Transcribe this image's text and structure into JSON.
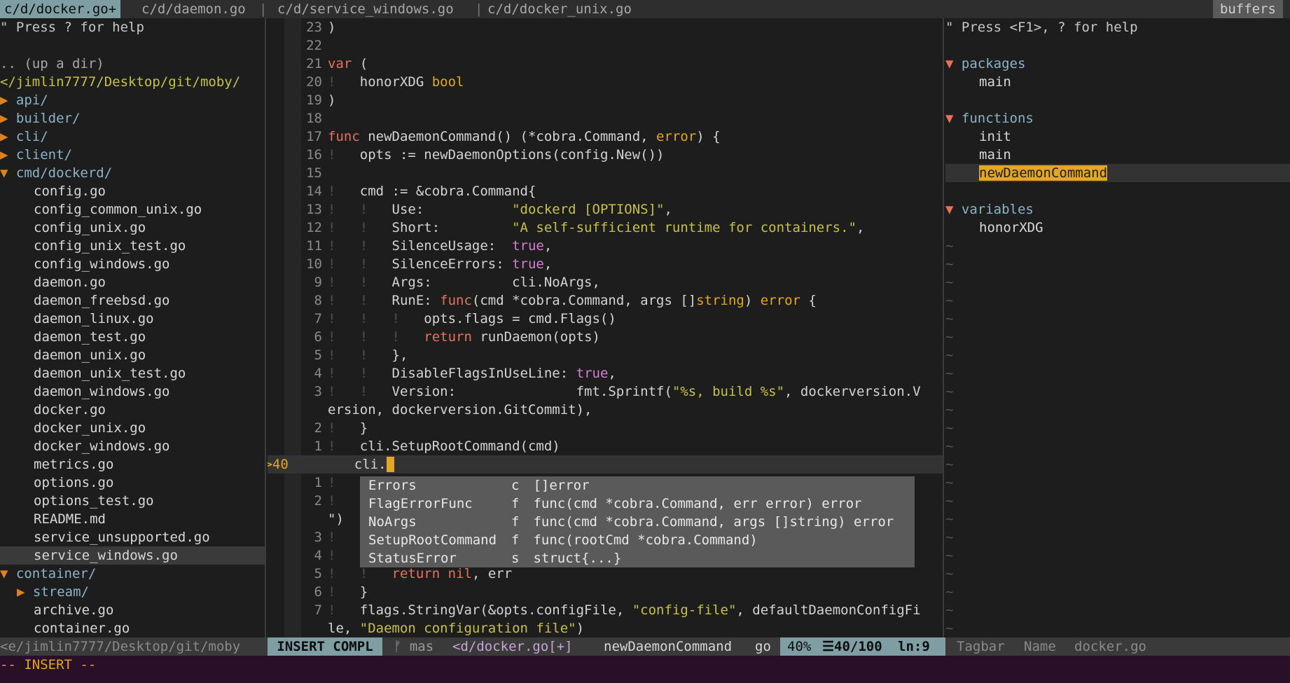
{
  "tabs": {
    "items": [
      {
        "label": "c/d/docker.go+",
        "active": true
      },
      {
        "label": "c/d/daemon.go",
        "active": false
      },
      {
        "label": "c/d/service_windows.go",
        "active": false
      },
      {
        "label": "c/d/docker_unix.go",
        "active": false
      }
    ],
    "separator": "|",
    "buffers_label": "buffers"
  },
  "tree": {
    "help": "\" Press ? for help",
    "up": ".. (up a dir)",
    "root": "</jimlin7777/Desktop/git/moby/",
    "entries": [
      {
        "type": "dir",
        "arrow": "▶",
        "name": "api/"
      },
      {
        "type": "dir",
        "arrow": "▶",
        "name": "builder/"
      },
      {
        "type": "dir",
        "arrow": "▶",
        "name": "cli/"
      },
      {
        "type": "dir",
        "arrow": "▶",
        "name": "client/"
      },
      {
        "type": "dir",
        "arrow": "▼",
        "name": "cmd/dockerd/"
      },
      {
        "type": "file",
        "name": "config.go"
      },
      {
        "type": "file",
        "name": "config_common_unix.go"
      },
      {
        "type": "file",
        "name": "config_unix.go"
      },
      {
        "type": "file",
        "name": "config_unix_test.go"
      },
      {
        "type": "file",
        "name": "config_windows.go"
      },
      {
        "type": "file",
        "name": "daemon.go"
      },
      {
        "type": "file",
        "name": "daemon_freebsd.go"
      },
      {
        "type": "file",
        "name": "daemon_linux.go"
      },
      {
        "type": "file",
        "name": "daemon_test.go"
      },
      {
        "type": "file",
        "name": "daemon_unix.go"
      },
      {
        "type": "file",
        "name": "daemon_unix_test.go"
      },
      {
        "type": "file",
        "name": "daemon_windows.go"
      },
      {
        "type": "file",
        "name": "docker.go"
      },
      {
        "type": "file",
        "name": "docker_unix.go"
      },
      {
        "type": "file",
        "name": "docker_windows.go"
      },
      {
        "type": "file",
        "name": "metrics.go"
      },
      {
        "type": "file",
        "name": "options.go"
      },
      {
        "type": "file",
        "name": "options_test.go"
      },
      {
        "type": "file",
        "name": "README.md"
      },
      {
        "type": "file",
        "name": "service_unsupported.go"
      },
      {
        "type": "file",
        "name": "service_windows.go",
        "selected": true
      },
      {
        "type": "dir",
        "arrow": "▼",
        "name": "container/"
      },
      {
        "type": "subdir",
        "arrow": "▶",
        "name": "stream/"
      },
      {
        "type": "file",
        "name": "archive.go"
      },
      {
        "type": "file",
        "name": "container.go"
      }
    ]
  },
  "editor": {
    "lines": [
      {
        "n": "23",
        "html": ")"
      },
      {
        "n": "22",
        "html": ""
      },
      {
        "n": "21",
        "html": "<span class=\"kw\">var</span> ("
      },
      {
        "n": "20",
        "html": "<span class=\"bang\">!</span>   honorXDG <span class=\"ty\">bool</span>"
      },
      {
        "n": "19",
        "html": ")"
      },
      {
        "n": "18",
        "html": ""
      },
      {
        "n": "17",
        "html": "<span class=\"kw\">func</span> newDaemonCommand() (*cobra.Command, <span class=\"ty\">error</span>) {"
      },
      {
        "n": "16",
        "html": "<span class=\"bang\">!</span>   opts := newDaemonOptions(config.New())"
      },
      {
        "n": "15",
        "html": ""
      },
      {
        "n": "14",
        "html": "<span class=\"bang\">!</span>   cmd := &amp;cobra.Command{"
      },
      {
        "n": "13",
        "html": "<span class=\"bang\">!   !</span>   Use:           <span class=\"str\">\"dockerd [OPTIONS]\"</span>,"
      },
      {
        "n": "12",
        "html": "<span class=\"bang\">!   !</span>   Short:         <span class=\"str\">\"A self-sufficient runtime for containers.\"</span>,"
      },
      {
        "n": "11",
        "html": "<span class=\"bang\">!   !</span>   SilenceUsage:  <span class=\"bool\">true</span>,"
      },
      {
        "n": "10",
        "html": "<span class=\"bang\">!   !</span>   SilenceErrors: <span class=\"bool\">true</span>,"
      },
      {
        "n": "9",
        "html": "<span class=\"bang\">!   !</span>   Args:          cli.NoArgs,"
      },
      {
        "n": "8",
        "html": "<span class=\"bang\">!   !</span>   RunE: <span class=\"kw\">func</span>(cmd *cobra.Command, args []<span class=\"ty\">string</span>) <span class=\"ty\">error</span> {"
      },
      {
        "n": "7",
        "html": "<span class=\"bang\">!   !   !</span>   opts.flags = cmd.Flags()"
      },
      {
        "n": "6",
        "html": "<span class=\"bang\">!   !   !</span>   <span class=\"kw\">return</span> runDaemon(opts)"
      },
      {
        "n": "5",
        "html": "<span class=\"bang\">!   !</span>   },"
      },
      {
        "n": "4",
        "html": "<span class=\"bang\">!   !</span>   DisableFlagsInUseLine: <span class=\"bool\">true</span>,"
      },
      {
        "n": "3",
        "html": "<span class=\"bang\">!   !</span>   Version:               fmt.Sprintf(<span class=\"str\">\"%s, build %s\"</span>, dockerversion.V"
      },
      {
        "n": "",
        "html": "ersion, dockerversion.GitCommit),"
      },
      {
        "n": "2",
        "html": "<span class=\"bang\">!</span>   }"
      },
      {
        "n": "1",
        "html": "<span class=\"bang\">!</span>   cli.SetupRootCommand(cmd)"
      },
      {
        "n": ">>40",
        "cur": true,
        "html": "    cli.<span class=\"cursor\"> </span>"
      },
      {
        "n": "1",
        "html": "<span class=\"bang\">!</span>   f"
      },
      {
        "n": "2",
        "html": "<span class=\"bang\">!</span>   f                                                                uit"
      },
      {
        "n": "",
        "html": "\")"
      },
      {
        "n": "3",
        "html": "<span class=\"bang\">!</span>   d"
      },
      {
        "n": "4",
        "html": "<span class=\"bang\">!</span>   i"
      },
      {
        "n": "5",
        "html": "<span class=\"bang\">!   !</span>   <span class=\"kw\">return</span> <span class=\"kw\">nil</span>, err"
      },
      {
        "n": "6",
        "html": "<span class=\"bang\">!</span>   }"
      },
      {
        "n": "7",
        "html": "<span class=\"bang\">!</span>   flags.StringVar(&amp;opts.configFile, <span class=\"str\">\"config-file\"</span>, defaultDaemonConfigFi"
      },
      {
        "n": "",
        "html": "le, <span class=\"str\">\"Daemon configuration file\"</span>)"
      }
    ]
  },
  "popup": {
    "items": [
      {
        "name": "Errors",
        "kind": "c",
        "sig": "[]error"
      },
      {
        "name": "FlagErrorFunc",
        "kind": "f",
        "sig": "func(cmd *cobra.Command, err error) error"
      },
      {
        "name": "NoArgs",
        "kind": "f",
        "sig": "func(cmd *cobra.Command, args []string) error"
      },
      {
        "name": "SetupRootCommand",
        "kind": "f",
        "sig": "func(rootCmd *cobra.Command)"
      },
      {
        "name": "StatusError",
        "kind": "s",
        "sig": "struct{...}"
      }
    ]
  },
  "tagbar": {
    "help": "\" Press <F1>, ? for help",
    "groups": [
      {
        "title": "packages",
        "items": [
          "main"
        ]
      },
      {
        "title": "functions",
        "items": [
          "init",
          "main",
          "newDaemonCommand"
        ],
        "highlight": "newDaemonCommand"
      },
      {
        "title": "variables",
        "items": [
          "honorXDG"
        ]
      }
    ],
    "arrow": "▼",
    "tilde": "~"
  },
  "status": {
    "tree_path": "<e/jimlin7777/Desktop/git/moby",
    "mode": "INSERT COMPL",
    "branch": "ᚠ mas",
    "file": "<d/docker.go[+]",
    "func": "newDaemonCommand",
    "ft": "go",
    "percent": "40%",
    "position": "☰40/100",
    "col": "ln:9",
    "tagbar": "Tagbar",
    "sort": "Name",
    "tagfile": "docker.go"
  },
  "cmdline": "-- INSERT --"
}
